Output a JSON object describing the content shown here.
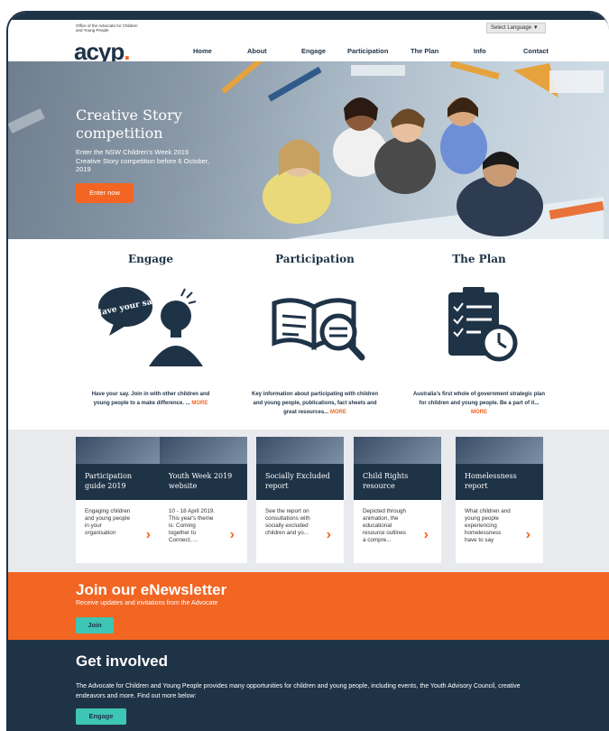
{
  "header": {
    "office_text": "Office of the Advocate for Children and Young People",
    "logo_text": "acyp",
    "logo_dot": ".",
    "language_select": "Select Language  ▼",
    "nav": [
      "Home",
      "About",
      "Engage",
      "Participation",
      "The Plan",
      "Info",
      "Contact"
    ]
  },
  "hero": {
    "title": "Creative Story competition",
    "text": "Enter the NSW Children's Week 2019 Creative Story competition before 6 October, 2019",
    "button": "Enter now"
  },
  "pillars": [
    {
      "heading": "Engage",
      "icon": "have-your-say-icon",
      "speech": "Have your say",
      "text": "Have your say. Join in with other children and young people to a make difference. ...",
      "more": "MORE"
    },
    {
      "heading": "Participation",
      "icon": "book-search-icon",
      "text": "Key information about participating with children and young people, publications, fact sheets and great resources...",
      "more": "MORE"
    },
    {
      "heading": "The Plan",
      "icon": "checklist-clock-icon",
      "text": "Australia's first whole of government strategic plan for children and young people. Be a part of it...",
      "more": "MORE"
    }
  ],
  "cards": [
    {
      "title": "Participation guide 2019",
      "desc": "Engaging children and young people in your organisation"
    },
    {
      "title": "Youth Week 2019 website",
      "desc": "10 - 18 April 2019. This year's theme is: Coming together to Connect, ..."
    },
    {
      "title": "Socially Excluded report",
      "desc": "See the report on consultations with socially excluded children and yo..."
    },
    {
      "title": "Child Rights resource",
      "desc": "Depicted through animation, the educational resource outlines a compre..."
    },
    {
      "title": "Homelessness report",
      "desc": "What children and young people experiencing homelessness have to say"
    }
  ],
  "newsletter": {
    "heading": "Join our eNewsletter",
    "text": "Receive updates and invitations from the Advocate",
    "button": "Join"
  },
  "involved": {
    "heading": "Get involved",
    "text": "The Advocate for Children and Young People provides many opportunities for children and young people, including events, the Youth Advisory Council, creative endeavors and more. Find out more below:",
    "button": "Engage"
  },
  "colors": {
    "navy": "#1f3347",
    "orange": "#f26522",
    "teal": "#3ec6b4"
  }
}
